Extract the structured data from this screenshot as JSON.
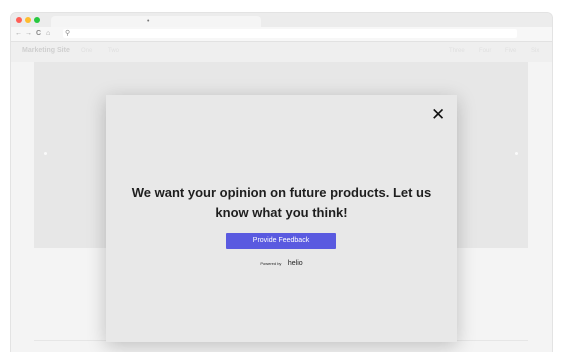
{
  "browser": {
    "traffic_lights": [
      "#ff5f57",
      "#febc2e",
      "#28c840"
    ],
    "tab_close": "•",
    "nav": {
      "back": "←",
      "forward": "→",
      "reload": "C",
      "home": "⌂",
      "search": "⚲"
    }
  },
  "site": {
    "brand": "Marketing Site",
    "nav_left": [
      "One",
      "Two"
    ],
    "nav_right": [
      "Three",
      "Four",
      "Five",
      "Six"
    ]
  },
  "modal": {
    "close": "✕",
    "headline": "We want your opinion on future products. Let us know what you think!",
    "button": "Provide Feedback",
    "powered_prefix": "Powered by",
    "powered_logo": "helio",
    "button_color": "#5a5ae0"
  }
}
